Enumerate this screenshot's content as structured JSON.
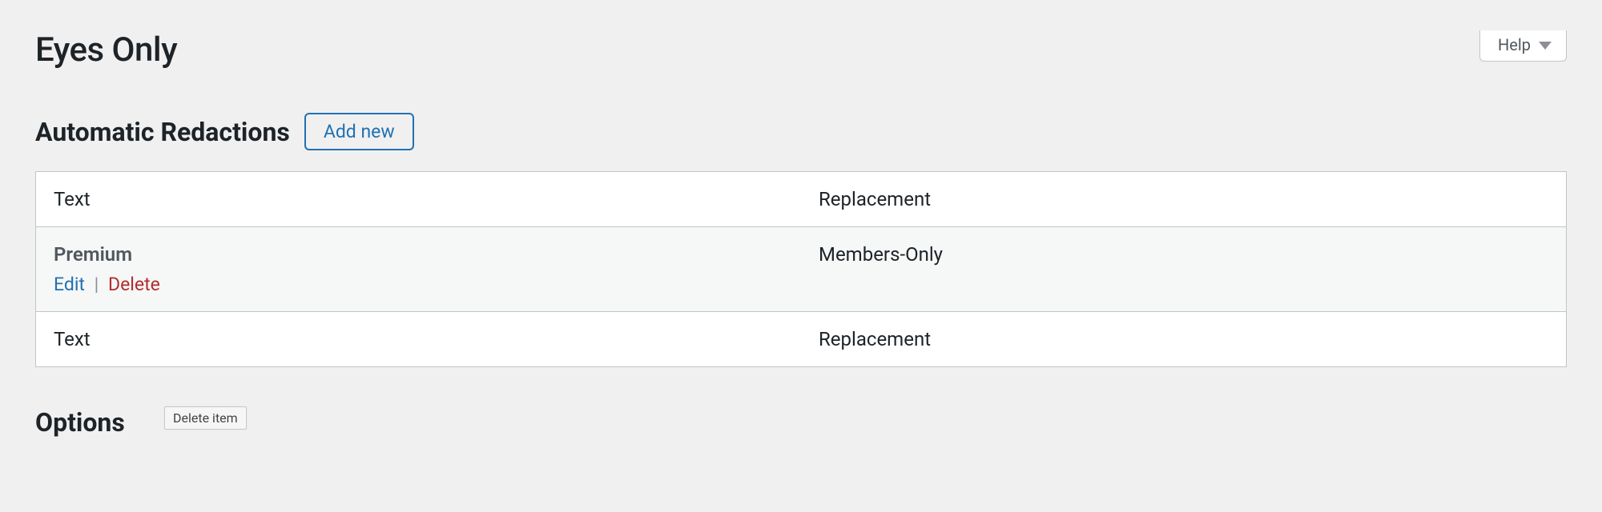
{
  "help": {
    "label": "Help"
  },
  "page": {
    "title": "Eyes Only"
  },
  "redactions": {
    "heading": "Automatic Redactions",
    "add_new": "Add new",
    "columns": {
      "text": "Text",
      "replacement": "Replacement"
    },
    "rows": [
      {
        "text": "Premium",
        "replacement": "Members-Only",
        "actions": {
          "edit": "Edit",
          "sep": "|",
          "delete": "Delete"
        }
      }
    ]
  },
  "tooltip": {
    "delete_item": "Delete item"
  },
  "options": {
    "heading": "Options"
  }
}
